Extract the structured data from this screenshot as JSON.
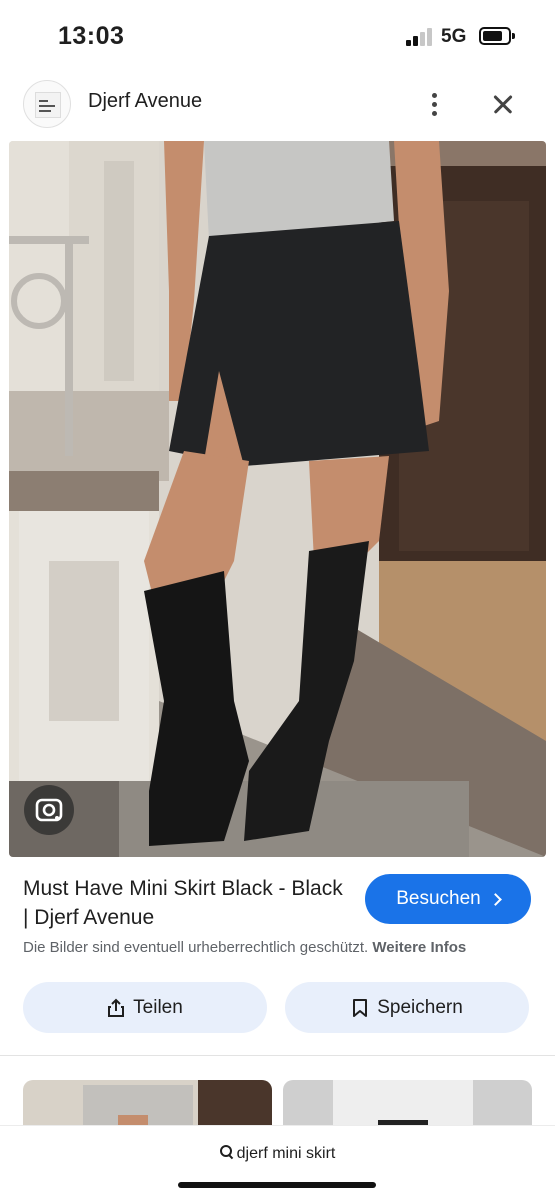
{
  "status_bar": {
    "time": "13:03",
    "network": "5G"
  },
  "header": {
    "site_name": "Djerf Avenue",
    "icons": [
      "site-favicon",
      "more-vert-icon",
      "close-icon"
    ]
  },
  "image_viewer": {
    "lens_icon": "google-lens-icon"
  },
  "result": {
    "title": "Must Have Mini Skirt Black - Black | Djerf Avenue",
    "visit_label": "Besuchen",
    "copyright_note": "Die Bilder sind eventuell urheberrechtlich geschützt.",
    "more_info": "Weitere Infos"
  },
  "actions": {
    "share_label": "Teilen",
    "save_label": "Speichern"
  },
  "search": {
    "query": "djerf mini skirt"
  },
  "colors": {
    "accent": "#1a73e8",
    "chip_bg": "#e8effb"
  }
}
